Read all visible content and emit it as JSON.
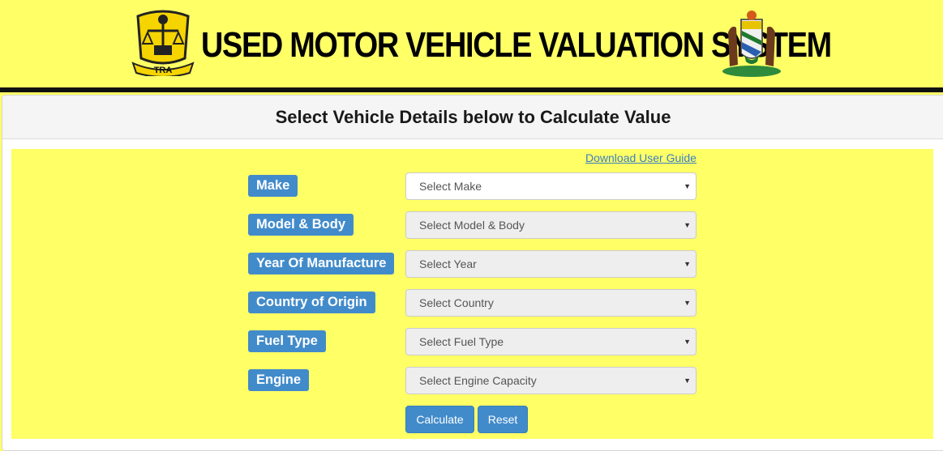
{
  "header": {
    "title": "USED MOTOR VEHICLE VALUATION SYSTEM",
    "logo_left_text": "TRA"
  },
  "panel": {
    "heading": "Select Vehicle Details below to Calculate Value",
    "guide_link": "Download User Guide"
  },
  "form": {
    "fields": [
      {
        "label": "Make",
        "placeholder": "Select Make"
      },
      {
        "label": "Model & Body",
        "placeholder": "Select Model & Body"
      },
      {
        "label": "Year Of Manufacture",
        "placeholder": "Select Year"
      },
      {
        "label": "Country of Origin",
        "placeholder": "Select Country"
      },
      {
        "label": "Fuel Type",
        "placeholder": "Select Fuel Type"
      },
      {
        "label": "Engine",
        "placeholder": "Select Engine Capacity"
      }
    ],
    "calculate_label": "Calculate",
    "reset_label": "Reset"
  },
  "colors": {
    "page_background": "#ffff66",
    "accent": "#428bca",
    "link": "#3a7fc4"
  },
  "icons": {
    "caret": "chevron-down-icon"
  }
}
